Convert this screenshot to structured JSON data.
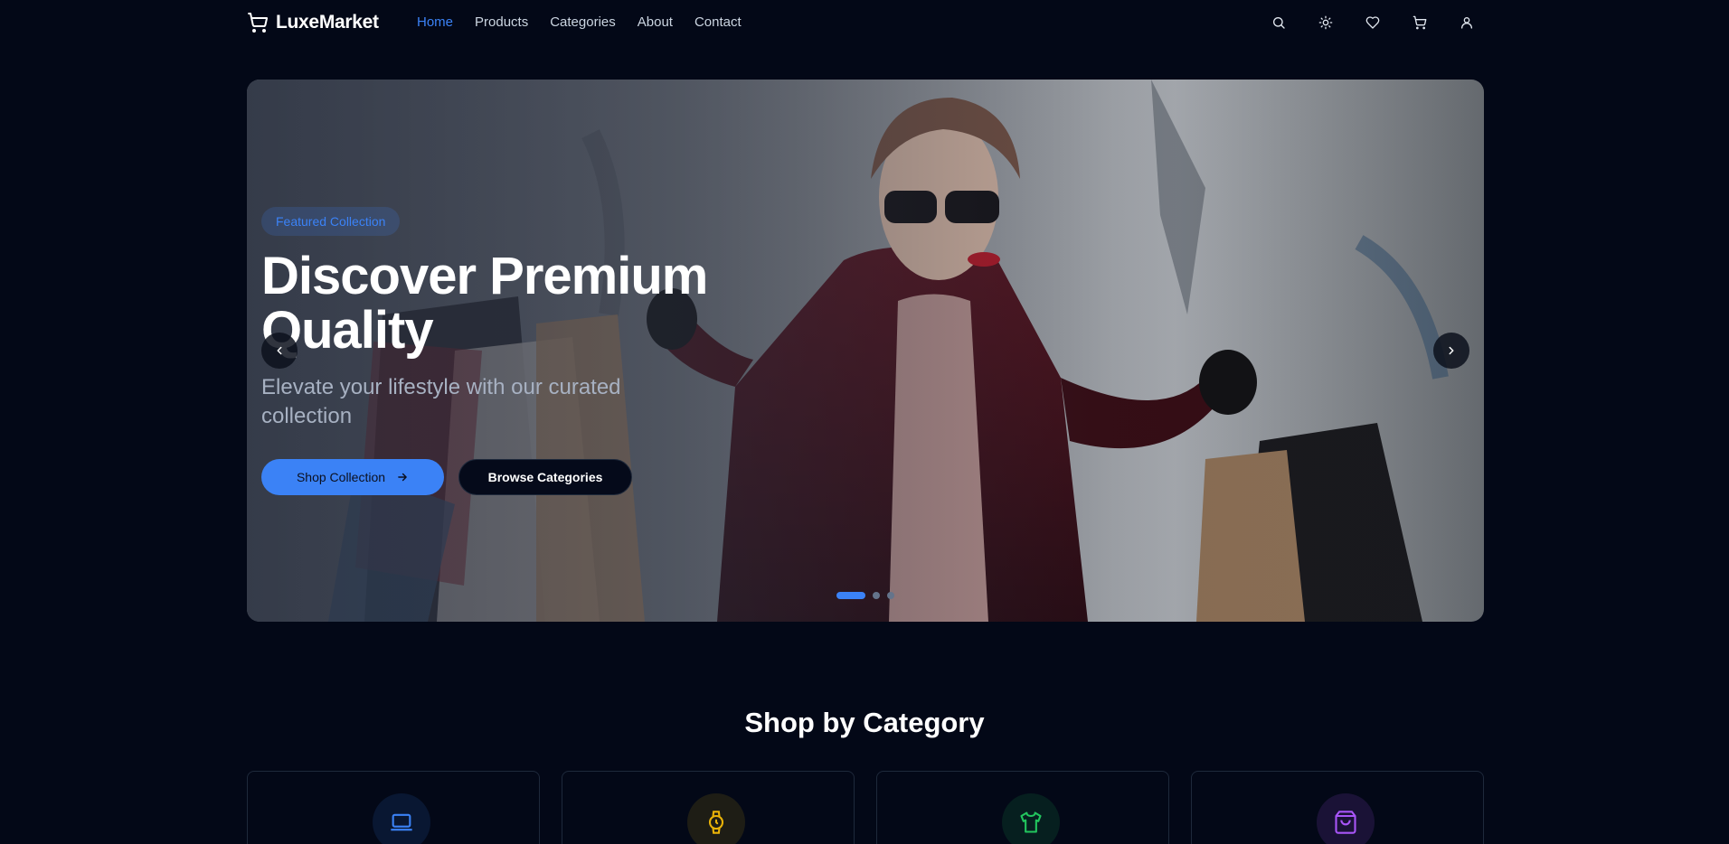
{
  "brand": {
    "name": "LuxeMarket",
    "icon": "shopping-cart-icon"
  },
  "nav": [
    {
      "label": "Home",
      "active": true
    },
    {
      "label": "Products",
      "active": false
    },
    {
      "label": "Categories",
      "active": false
    },
    {
      "label": "About",
      "active": false
    },
    {
      "label": "Contact",
      "active": false
    }
  ],
  "header_icons": [
    "search-icon",
    "sun-icon",
    "heart-icon",
    "cart-icon",
    "user-icon"
  ],
  "hero": {
    "badge": "Featured Collection",
    "title": "Discover Premium Quality",
    "subtitle": "Elevate your lifestyle with our curated collection",
    "primary_button": "Shop Collection",
    "secondary_button": "Browse Categories",
    "slides_total": 3,
    "active_slide": 1
  },
  "categories_section": {
    "title": "Shop by Category",
    "items": [
      {
        "icon": "laptop-icon",
        "color": "#3b82f6"
      },
      {
        "icon": "watch-icon",
        "color": "#eab308"
      },
      {
        "icon": "shirt-icon",
        "color": "#22c55e"
      },
      {
        "icon": "shopping-bag-icon",
        "color": "#a855f7"
      }
    ]
  },
  "colors": {
    "accent": "#3b82f6",
    "background": "#030817"
  }
}
